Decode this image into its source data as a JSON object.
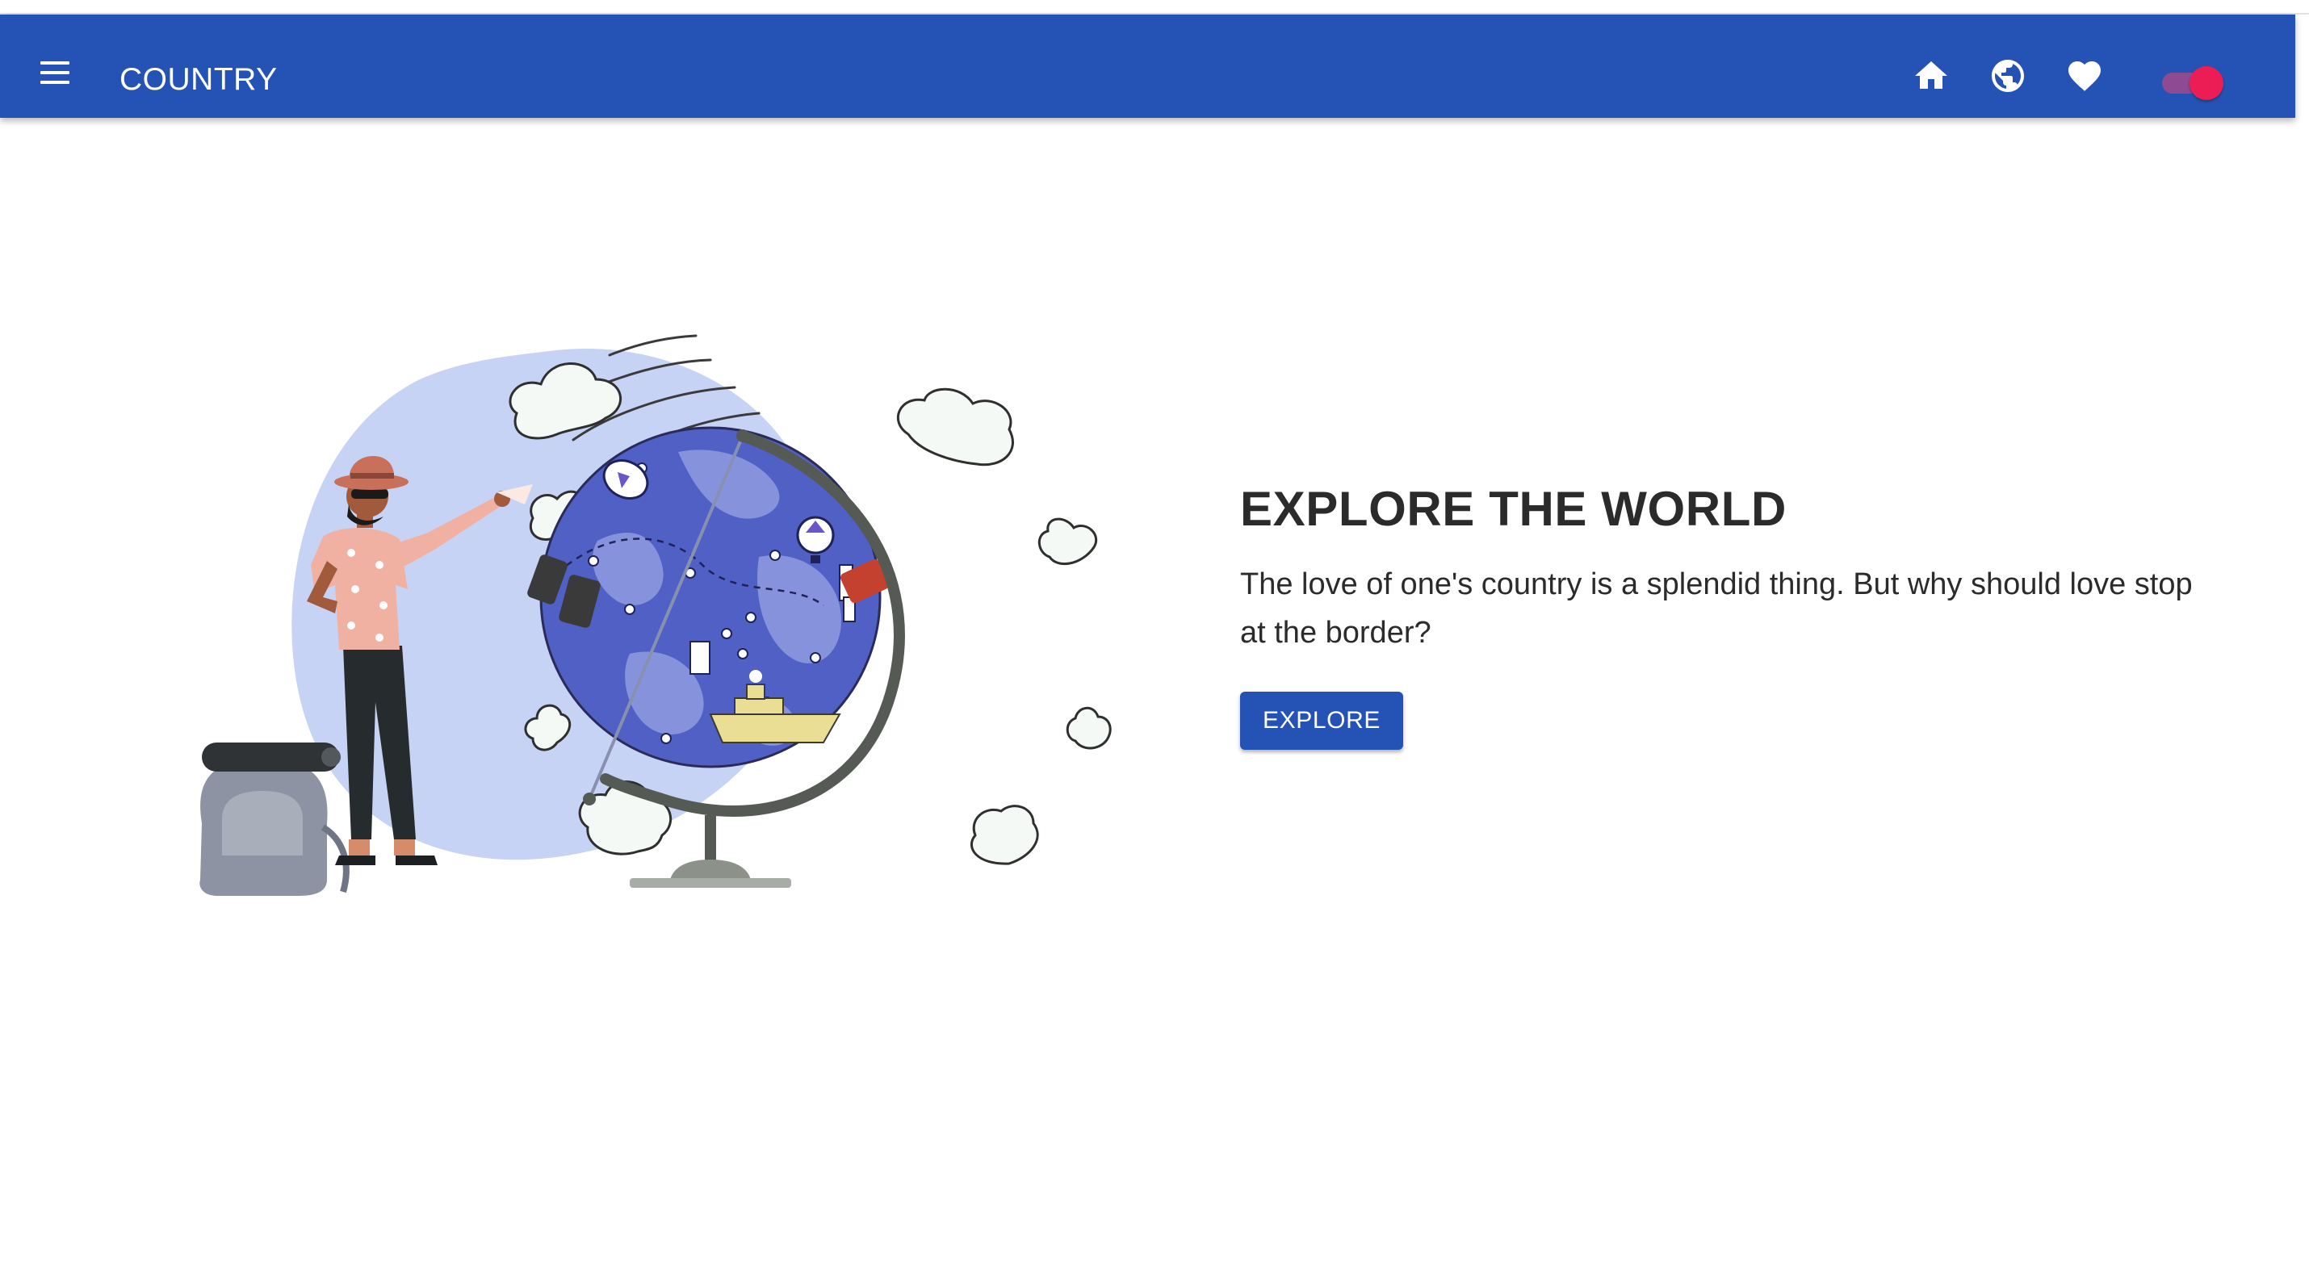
{
  "appbar": {
    "title": "COUNTRY",
    "background_color": "#2553b5",
    "icons": [
      "menu-icon",
      "home-icon",
      "globe-icon",
      "heart-icon"
    ],
    "theme_toggle": {
      "on": true,
      "color": "#ec1d55"
    }
  },
  "hero": {
    "title": "EXPLORE THE WORLD",
    "text": "The love of one's country is a splendid thing. But why should love stop at the border?",
    "button_label": "EXPLORE"
  },
  "illustration": {
    "subject": "traveler-with-globe",
    "globe_color": "#5160c4",
    "backdrop_color": "#c7d3f5"
  }
}
